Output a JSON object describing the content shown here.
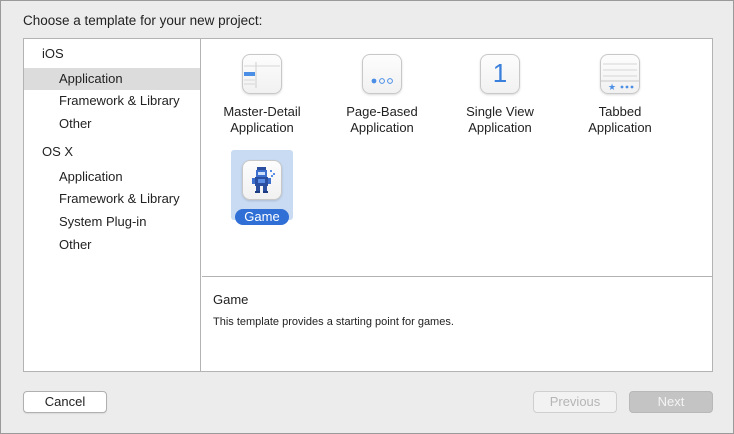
{
  "dialog": {
    "title": "Choose a template for your new project:"
  },
  "sidebar": {
    "sections": [
      {
        "header": "iOS",
        "items": [
          {
            "label": "Application",
            "selected": true
          },
          {
            "label": "Framework & Library",
            "selected": false
          },
          {
            "label": "Other",
            "selected": false
          }
        ]
      },
      {
        "header": "OS X",
        "items": [
          {
            "label": "Application",
            "selected": false
          },
          {
            "label": "Framework & Library",
            "selected": false
          },
          {
            "label": "System Plug-in",
            "selected": false
          },
          {
            "label": "Other",
            "selected": false
          }
        ]
      }
    ]
  },
  "templates": [
    {
      "label": "Master-Detail\nApplication",
      "icon": "master-detail-icon"
    },
    {
      "label": "Page-Based\nApplication",
      "icon": "page-based-icon"
    },
    {
      "label": "Single View\nApplication",
      "icon": "single-view-icon",
      "glyph": "1"
    },
    {
      "label": "Tabbed\nApplication",
      "icon": "tabbed-icon"
    },
    {
      "label": "Game",
      "icon": "game-icon",
      "selected": true
    }
  ],
  "description": {
    "title": "Game",
    "text": "This template provides a starting point for games."
  },
  "buttons": {
    "cancel": "Cancel",
    "previous": "Previous",
    "next": "Next"
  },
  "colors": {
    "accent": "#2f6fd6",
    "selection_highlight": "#c9dbf2",
    "sidebar_selected": "#dcdcdc"
  }
}
